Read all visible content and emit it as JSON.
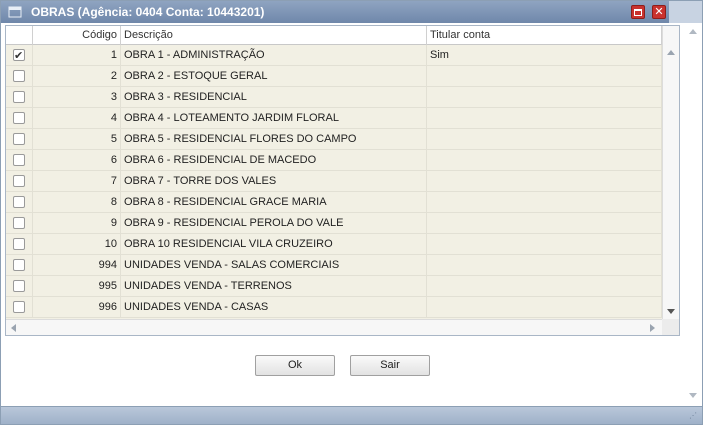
{
  "window": {
    "title": "OBRAS (Agência: 0404 Conta: 10443201)",
    "icons": {
      "title": "window-icon",
      "maximize": "maximize-icon",
      "close": "close-icon"
    }
  },
  "grid": {
    "columns": [
      "",
      "Código",
      "Descrição",
      "Titular conta"
    ],
    "rows": [
      {
        "checked": true,
        "codigo": "1",
        "descricao": "OBRA 1 - ADMINISTRAÇÃO",
        "titular": "Sim"
      },
      {
        "checked": false,
        "codigo": "2",
        "descricao": "OBRA 2 - ESTOQUE GERAL",
        "titular": ""
      },
      {
        "checked": false,
        "codigo": "3",
        "descricao": "OBRA 3 - RESIDENCIAL",
        "titular": ""
      },
      {
        "checked": false,
        "codigo": "4",
        "descricao": "OBRA 4 - LOTEAMENTO JARDIM FLORAL",
        "titular": ""
      },
      {
        "checked": false,
        "codigo": "5",
        "descricao": "OBRA 5 - RESIDENCIAL FLORES DO CAMPO",
        "titular": ""
      },
      {
        "checked": false,
        "codigo": "6",
        "descricao": "OBRA 6 - RESIDENCIAL DE MACEDO",
        "titular": ""
      },
      {
        "checked": false,
        "codigo": "7",
        "descricao": "OBRA 7 - TORRE DOS VALES",
        "titular": ""
      },
      {
        "checked": false,
        "codigo": "8",
        "descricao": "OBRA 8 - RESIDENCIAL GRACE MARIA",
        "titular": ""
      },
      {
        "checked": false,
        "codigo": "9",
        "descricao": "OBRA 9 - RESIDENCIAL PEROLA DO VALE",
        "titular": ""
      },
      {
        "checked": false,
        "codigo": "10",
        "descricao": "OBRA 10 RESIDENCIAL VILA CRUZEIRO",
        "titular": ""
      },
      {
        "checked": false,
        "codigo": "994",
        "descricao": "UNIDADES VENDA - SALAS COMERCIAIS",
        "titular": ""
      },
      {
        "checked": false,
        "codigo": "995",
        "descricao": "UNIDADES VENDA - TERRENOS",
        "titular": ""
      },
      {
        "checked": false,
        "codigo": "996",
        "descricao": "UNIDADES VENDA - CASAS",
        "titular": ""
      }
    ]
  },
  "buttons": {
    "ok": "Ok",
    "sair": "Sair"
  },
  "colors": {
    "titlebar": "#7b91b3",
    "row_bg": "#f2f0e4",
    "close_button": "#c9322e"
  }
}
